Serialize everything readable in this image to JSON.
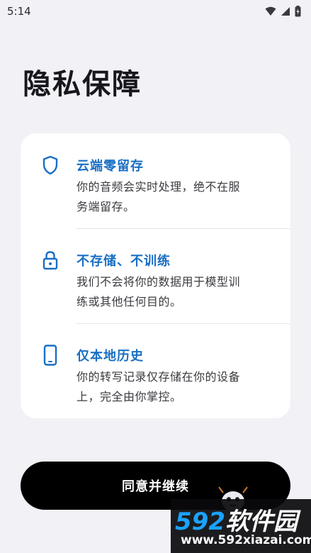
{
  "status_bar": {
    "time": "5:14"
  },
  "page": {
    "title": "隐私保障"
  },
  "items": [
    {
      "icon": "shield-icon",
      "title": "云端零留存",
      "desc_line1": "你的音频会实时处理，绝不在服",
      "desc_line2": "务端留存。"
    },
    {
      "icon": "lock-icon",
      "title": "不存储、不训练",
      "desc_line1": "我们不会将你的数据用于模型训",
      "desc_line2": "练或其他任何目的。"
    },
    {
      "icon": "phone-icon",
      "title": "仅本地历史",
      "desc_line1": "你的转写记录仅存储在你的设备",
      "desc_line2": "上，完全由你掌控。"
    }
  ],
  "continue_button": {
    "label": "同意并继续"
  },
  "watermark": {
    "brand_num": "592",
    "brand_text": "软件园",
    "url": "www.592xiazai.com"
  },
  "colors": {
    "accent": "#1a6fc4",
    "background": "#f1f1f6",
    "card": "#ffffff",
    "button": "#000000"
  }
}
